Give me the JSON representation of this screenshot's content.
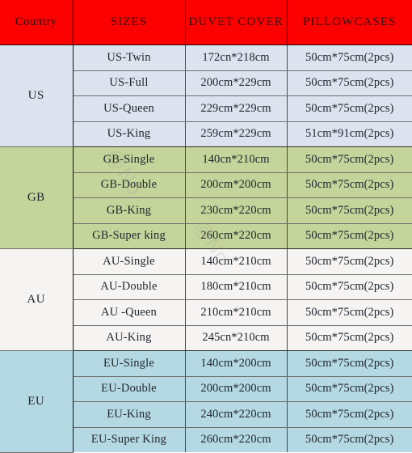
{
  "table": {
    "columns": [
      {
        "key": "country",
        "label": "Country"
      },
      {
        "key": "sizes",
        "label": "SIZES"
      },
      {
        "key": "duvet",
        "label": "DUVET COVER"
      },
      {
        "key": "pillow",
        "label": "PILLOWCASES"
      }
    ],
    "header_bg": "#fc0000",
    "header_text_color": "#2a1210",
    "bands": [
      {
        "country": "US",
        "bg": "#dde3ee",
        "rows": [
          {
            "sizes": "US-Twin",
            "duvet": "172cn*218cm",
            "pillow": "50cm*75cm(2pcs)"
          },
          {
            "sizes": "US-Full",
            "duvet": "200cm*229cm",
            "pillow": "50cm*75cm(2pcs)"
          },
          {
            "sizes": "US-Queen",
            "duvet": "229cm*229cm",
            "pillow": "50cm*75cm(2pcs)"
          },
          {
            "sizes": "US-King",
            "duvet": "259cm*229cm",
            "pillow": "51cm*91cm(2pcs)"
          }
        ]
      },
      {
        "country": "GB",
        "bg": "#c5d49a",
        "rows": [
          {
            "sizes": "GB-Single",
            "duvet": "140cn*210cm",
            "pillow": "50cm*75cm(2pcs)"
          },
          {
            "sizes": "GB-Double",
            "duvet": "200cm*200cm",
            "pillow": "50cm*75cm(2pcs)"
          },
          {
            "sizes": "GB-King",
            "duvet": "230cm*220cm",
            "pillow": "50cm*75cm(2pcs)"
          },
          {
            "sizes": "GB-Super king",
            "duvet": "260cm*220cm",
            "pillow": "50cm*75cm(2pcs)"
          }
        ]
      },
      {
        "country": "AU",
        "bg": "#f5f4f2",
        "rows": [
          {
            "sizes": "AU-Single",
            "duvet": "140cm*210cm",
            "pillow": "50cm*75cm(2pcs)"
          },
          {
            "sizes": "AU-Double",
            "duvet": "180cm*210cm",
            "pillow": "50cm*75cm(2pcs)"
          },
          {
            "sizes": "AU -Queen",
            "duvet": "210cm*210cm",
            "pillow": "50cm*75cm(2pcs)"
          },
          {
            "sizes": "AU-King",
            "duvet": "245cn*210cm",
            "pillow": "50cm*75cm(2pcs)"
          }
        ]
      },
      {
        "country": "EU",
        "bg": "#b4d9e2",
        "rows": [
          {
            "sizes": "EU-Single",
            "duvet": "140cm*200cm",
            "pillow": "50cm*75cm(2pcs)"
          },
          {
            "sizes": "EU-Double",
            "duvet": "200cm*200cm",
            "pillow": "50cm*75cm(2pcs)"
          },
          {
            "sizes": "EU-King",
            "duvet": "240cm*220cm",
            "pillow": "50cm*75cm(2pcs)"
          },
          {
            "sizes": "EU-Super King",
            "duvet": "260cm*220cm",
            "pillow": "50cm*75cm(2pcs)"
          }
        ]
      }
    ]
  },
  "watermark": {
    "line1": "@No",
    "line2": "@No"
  }
}
